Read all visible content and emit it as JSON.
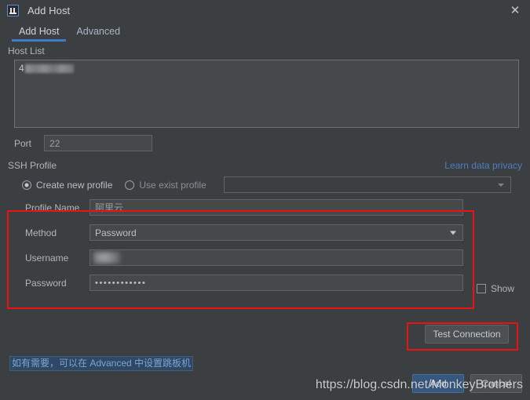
{
  "window": {
    "title": "Add Host",
    "icon": "intellij-idea-icon",
    "close_label": "✕"
  },
  "tabs": [
    {
      "label": "Add Host",
      "active": true
    },
    {
      "label": "Advanced",
      "active": false
    }
  ],
  "host_list": {
    "label": "Host List",
    "entry_number": "4",
    "entry_value_redacted": true
  },
  "port": {
    "label": "Port",
    "value": "22"
  },
  "ssh_profile": {
    "label": "SSH Profile",
    "privacy_link": "Learn data privacy",
    "create_new_label": "Create new profile",
    "use_exist_label": "Use exist profile",
    "selected_mode": "create_new",
    "existing_profile_value": ""
  },
  "form": {
    "profile_name": {
      "label": "Profile Name",
      "value": "阿里云"
    },
    "method": {
      "label": "Method",
      "value": "Password"
    },
    "username": {
      "label": "Username",
      "value": "",
      "redacted": true
    },
    "password": {
      "label": "Password",
      "value": "••••••••••••"
    },
    "show_checkbox": {
      "label": "Show",
      "checked": false
    }
  },
  "actions": {
    "test_connection": "Test Connection",
    "add": "Add",
    "cancel": "Cancel"
  },
  "hint": "如有需要，可以在 Advanced 中设置跳板机",
  "watermark": "https://blog.csdn.net/MonkeyBrothers",
  "colors": {
    "background": "#3c3f41",
    "field_background": "#45494a",
    "accent_tab": "#3d7dcc",
    "link": "#4c7ec4",
    "highlight_box": "#ee1111",
    "primary_button": "#365880"
  }
}
